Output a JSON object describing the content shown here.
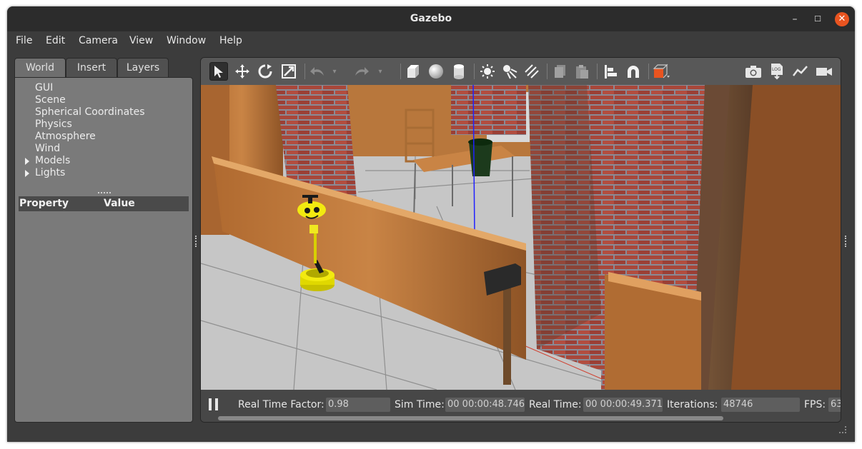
{
  "window": {
    "title": "Gazebo",
    "minimize": "–",
    "maximize": "☐",
    "close": "✕"
  },
  "menu": [
    "File",
    "Edit",
    "Camera",
    "View",
    "Window",
    "Help"
  ],
  "left_panel": {
    "tabs": [
      "World",
      "Insert",
      "Layers"
    ],
    "active_tab": "World",
    "tree": [
      "GUI",
      "Scene",
      "Spherical Coordinates",
      "Physics",
      "Atmosphere",
      "Wind",
      "Models",
      "Lights"
    ],
    "expandable": [
      "Models",
      "Lights"
    ],
    "property_header": {
      "property": "Property",
      "value": "Value"
    }
  },
  "toolbar": {
    "icons": [
      "select-mode-icon",
      "translate-mode-icon",
      "rotate-mode-icon",
      "scale-mode-icon",
      "undo-icon",
      "undo-history-icon",
      "redo-icon",
      "redo-history-icon",
      "box-icon",
      "sphere-icon",
      "cylinder-icon",
      "point-light-icon",
      "spot-light-icon",
      "directional-light-icon",
      "copy-icon",
      "paste-icon",
      "align-icon",
      "snap-icon",
      "view-angle-icon",
      "screenshot-icon",
      "log-icon",
      "plot-icon",
      "video-record-icon"
    ]
  },
  "status": {
    "real_time_factor_label": "Real Time Factor:",
    "real_time_factor": "0.98",
    "sim_time_label": "Sim Time:",
    "sim_time": "00 00:00:48.746",
    "real_time_label": "Real Time:",
    "real_time": "00 00:00:49.371",
    "iterations_label": "Iterations:",
    "iterations": "48746",
    "fps_label": "FPS:",
    "fps": "63"
  },
  "colors": {
    "accent": "#e95420",
    "window_bg": "#3c3c3c",
    "robot": "#e8e000"
  }
}
